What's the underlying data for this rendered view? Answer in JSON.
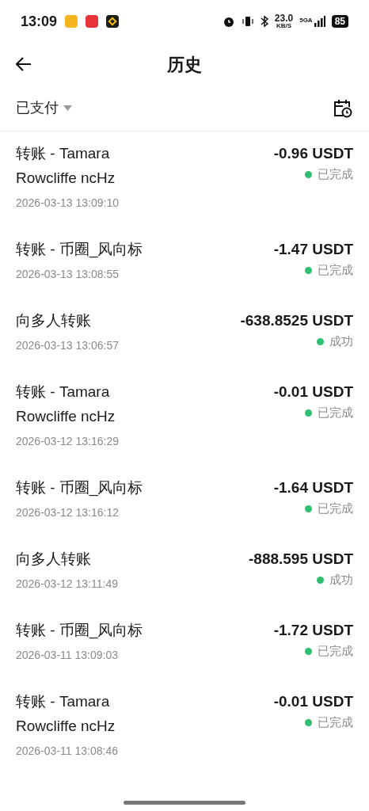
{
  "status_bar": {
    "time": "13:09",
    "network_speed": "23.0",
    "speed_unit": "KB/S",
    "network_type": "5GA",
    "battery": "85"
  },
  "header": {
    "title": "历史"
  },
  "filter": {
    "label": "已支付"
  },
  "transactions": [
    {
      "name": "转账 - Tamara Rowcliffe ncHz",
      "amount": "-0.96 USDT",
      "status": "已完成",
      "color": "#2fbf71",
      "time": "2026-03-13 13:09:10"
    },
    {
      "name": "转账 - 币圈_风向标",
      "amount": "-1.47 USDT",
      "status": "已完成",
      "color": "#2fbf71",
      "time": "2026-03-13 13:08:55"
    },
    {
      "name": "向多人转账",
      "amount": "-638.8525 USDT",
      "status": "成功",
      "color": "#2fbf71",
      "time": "2026-03-13 13:06:57"
    },
    {
      "name": "转账 - Tamara Rowcliffe ncHz",
      "amount": "-0.01 USDT",
      "status": "已完成",
      "color": "#2fbf71",
      "time": "2026-03-12 13:16:29"
    },
    {
      "name": "转账 - 币圈_风向标",
      "amount": "-1.64 USDT",
      "status": "已完成",
      "color": "#2fbf71",
      "time": "2026-03-12 13:16:12"
    },
    {
      "name": "向多人转账",
      "amount": "-888.595 USDT",
      "status": "成功",
      "color": "#2fbf71",
      "time": "2026-03-12 13:11:49"
    },
    {
      "name": "转账 - 币圈_风向标",
      "amount": "-1.72 USDT",
      "status": "已完成",
      "color": "#2fbf71",
      "time": "2026-03-11 13:09:03"
    },
    {
      "name": "转账 - Tamara Rowcliffe ncHz",
      "amount": "-0.01 USDT",
      "status": "已完成",
      "color": "#2fbf71",
      "time": "2026-03-11 13:08:46"
    }
  ]
}
